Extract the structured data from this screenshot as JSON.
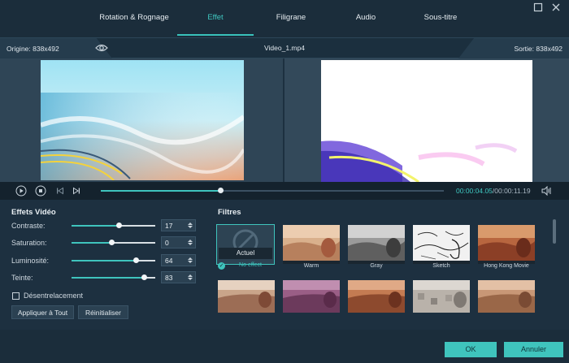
{
  "tabs": [
    {
      "label": "Rotation & Rognage"
    },
    {
      "label": "Effet"
    },
    {
      "label": "Filigrane"
    },
    {
      "label": "Audio"
    },
    {
      "label": "Sous-titre"
    }
  ],
  "window": {
    "maximize_icon": "maximize-icon",
    "close_icon": "close-icon"
  },
  "info": {
    "origin": "Origine: 838x492",
    "filename": "Video_1.mp4",
    "sortie": "Sortie: 838x492"
  },
  "player": {
    "current_time": "00:00:04.05",
    "total_time": "/00:00:11.19",
    "progress": 0.35
  },
  "effects": {
    "title": "Effets Vidéo",
    "sliders": [
      {
        "label": "Contraste:",
        "value": "17",
        "level": 0.57
      },
      {
        "label": "Saturation:",
        "value": "0",
        "level": 0.48
      },
      {
        "label": "Luminosité:",
        "value": "64",
        "level": 0.78
      },
      {
        "label": "Teinte:",
        "value": "83",
        "level": 0.87
      }
    ],
    "deinterlace_label": "Désentrelacement",
    "apply_all": "Appliquer à Tout",
    "reset": "Réinitialiser"
  },
  "filters": {
    "title": "Filtres",
    "selected_caption": "Actuel",
    "items": [
      {
        "label": "No effect"
      },
      {
        "label": "Warm"
      },
      {
        "label": "Gray"
      },
      {
        "label": "Sketch"
      },
      {
        "label": "Hong Kong Movie"
      }
    ]
  },
  "footer": {
    "ok": "OK",
    "cancel": "Annuler"
  },
  "colors": {
    "accent": "#3fc4bd",
    "background": "#1d3040"
  }
}
